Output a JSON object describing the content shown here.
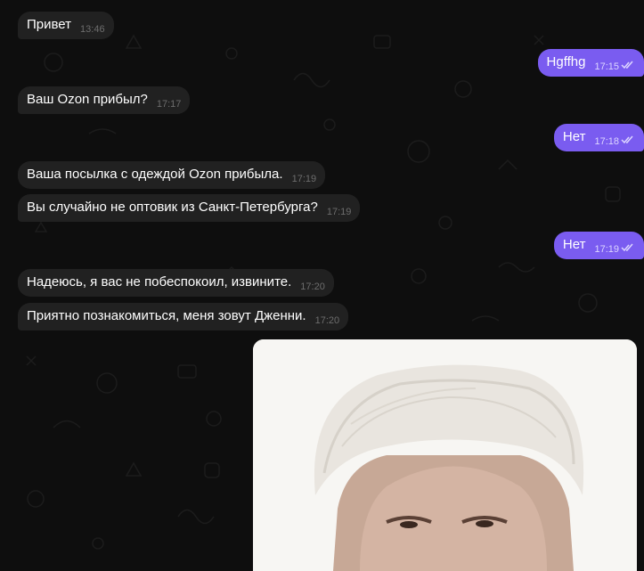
{
  "messages": [
    {
      "dir": "in",
      "text": "Привет",
      "time": "13:46"
    },
    {
      "dir": "out",
      "text": "Hgffhg",
      "time": "17:15"
    },
    {
      "dir": "in",
      "text": "Ваш Ozon прибыл?",
      "time": "17:17"
    },
    {
      "dir": "out",
      "text": "Нет",
      "time": "17:18"
    },
    {
      "dir": "in",
      "text": "Ваша посылка с одеждой Ozon прибыла.",
      "time": "17:19"
    },
    {
      "dir": "in",
      "text": "Вы случайно не оптовик из Санкт-Петербурга?",
      "time": "17:19"
    },
    {
      "dir": "out",
      "text": "Нет",
      "time": "17:19"
    },
    {
      "dir": "in",
      "text": "Надеюсь, я вас не побеспокоил, извините.",
      "time": "17:20"
    },
    {
      "dir": "in",
      "text": "Приятно познакомиться, меня зовут Дженни.",
      "time": "17:20"
    }
  ],
  "photo": {
    "icon": "portrait-photo"
  },
  "colors": {
    "background": "#0e0e0e",
    "incoming_bubble": "#212121",
    "outgoing_bubble": "#7a5cf0",
    "incoming_time": "#6d6d6d",
    "outgoing_time": "#ddd6ff"
  }
}
